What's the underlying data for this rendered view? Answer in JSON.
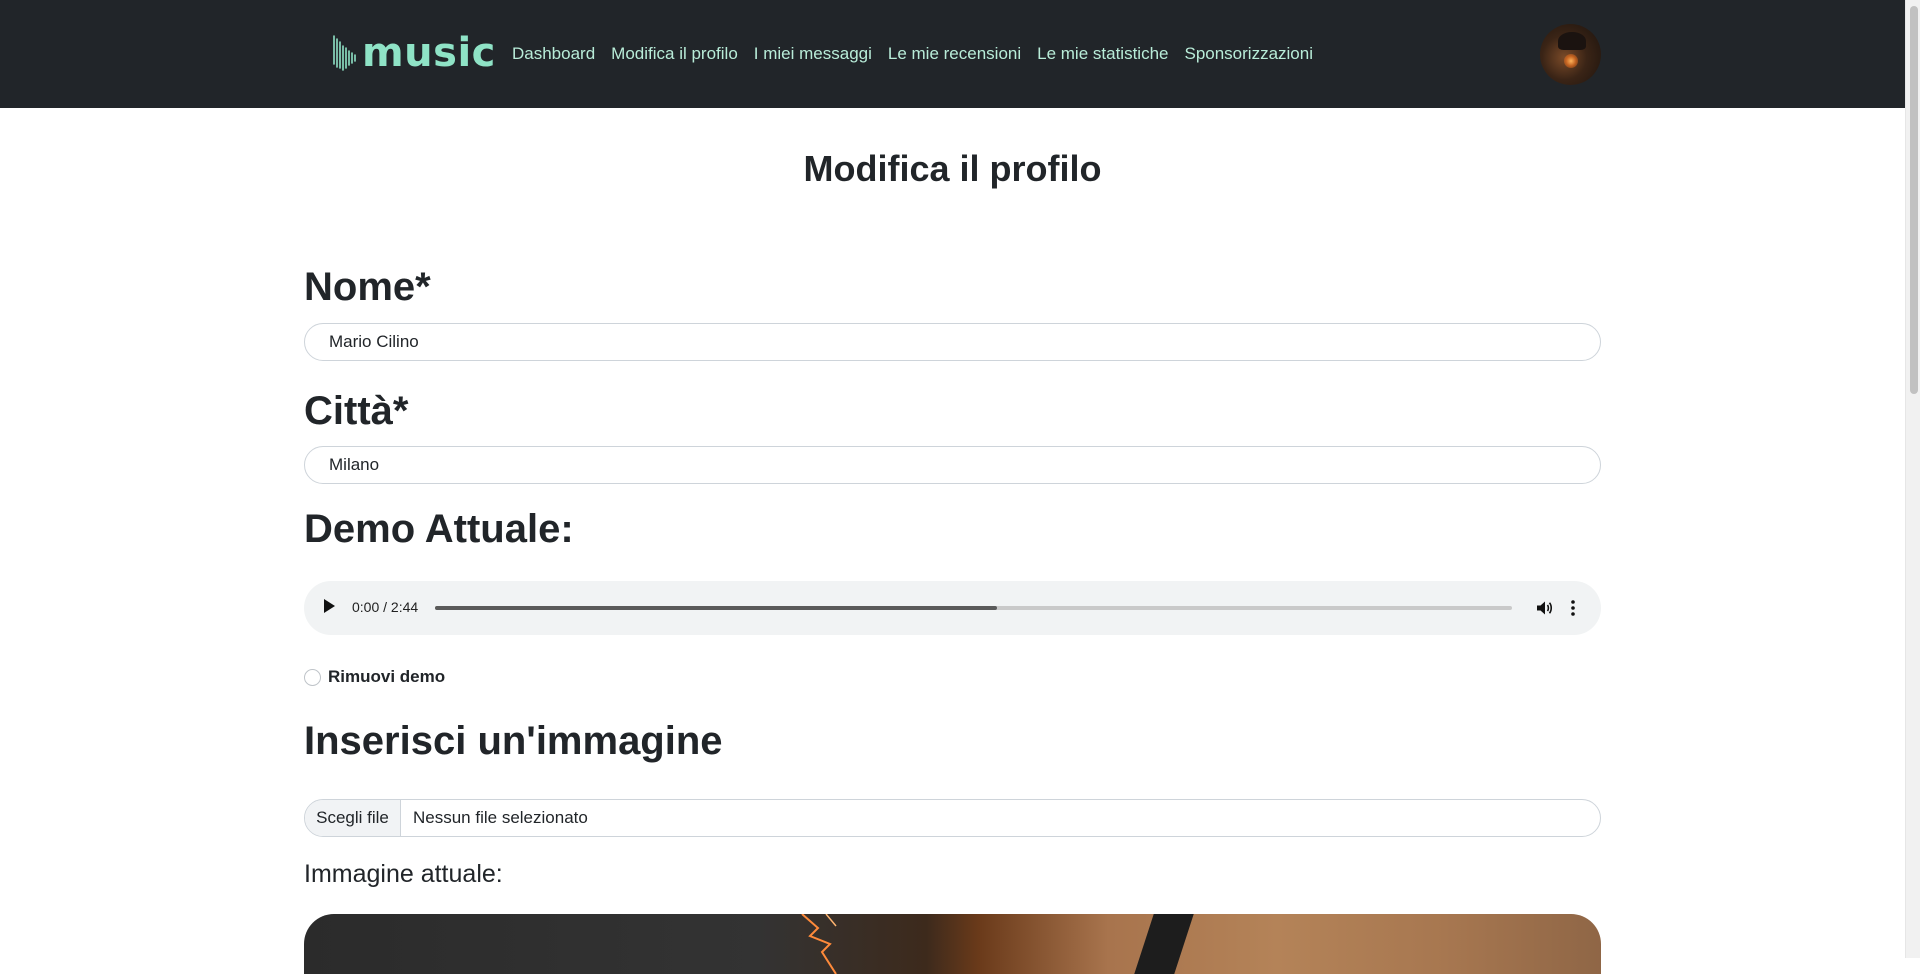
{
  "navbar": {
    "logo_text": "music",
    "links": [
      "Dashboard",
      "Modifica il profilo",
      "I miei messaggi",
      "Le mie recensioni",
      "Le mie statistiche",
      "Sponsorizzazioni"
    ]
  },
  "page": {
    "title": "Modifica il profilo"
  },
  "form": {
    "name_label": "Nome*",
    "name_value": "Mario Cilino",
    "city_label": "Città*",
    "city_value": "Milano",
    "demo_label": "Demo Attuale:",
    "audio": {
      "time_display": "0:00 / 2:44",
      "buffered_fraction": 0.522
    },
    "remove_demo_label": "Rimuovi demo",
    "image_label": "Inserisci un'immagine",
    "file_button_label": "Scegli file",
    "file_status": "Nessun file selezionato",
    "current_image_label": "Immagine attuale:"
  },
  "icons": {
    "logo": "sound-wave-icon",
    "play": "play-icon",
    "volume": "volume-icon",
    "more": "more-vertical-icon"
  },
  "colors": {
    "navbar_bg": "#212529",
    "accent": "#8fe3c6",
    "nav_link": "#b8ecd8"
  }
}
